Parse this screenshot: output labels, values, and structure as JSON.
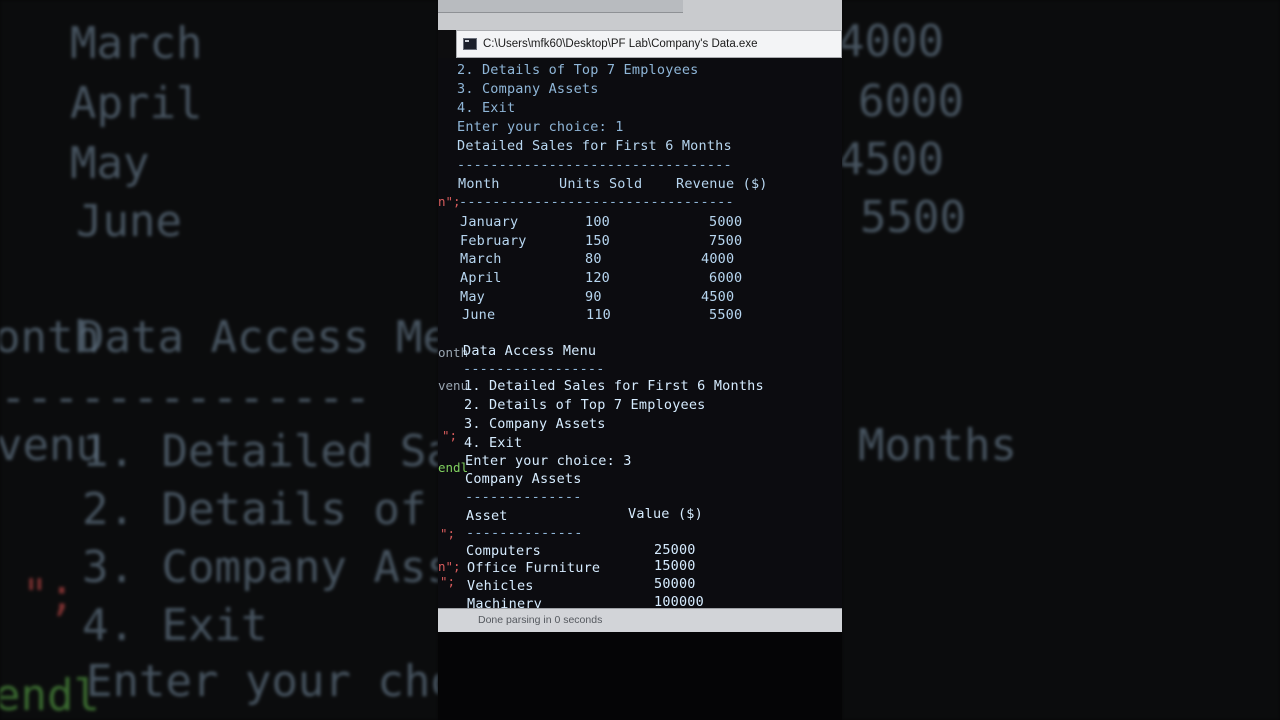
{
  "window": {
    "title": "C:\\Users\\mfk60\\Desktop\\PF Lab\\Company's Data.exe"
  },
  "console": {
    "menu_top": {
      "opt2": "2. Details of Top 7 Employees",
      "opt3": "3. Company Assets",
      "opt4": "4. Exit",
      "prompt": "Enter your choice: 1"
    },
    "sales": {
      "title": "Detailed Sales for First 6 Months",
      "divider": "---------------------------------",
      "header": {
        "month": "Month",
        "units": "Units Sold",
        "revenue": "Revenue ($)"
      },
      "divider2": "---------------------------------",
      "rows": [
        {
          "month": "January",
          "units": "100",
          "revenue": "5000"
        },
        {
          "month": "February",
          "units": "150",
          "revenue": "7500"
        },
        {
          "month": "March",
          "units": "80",
          "revenue": "4000"
        },
        {
          "month": "April",
          "units": "120",
          "revenue": "6000"
        },
        {
          "month": "May",
          "units": "90",
          "revenue": "4500"
        },
        {
          "month": "June",
          "units": "110",
          "revenue": "5500"
        }
      ]
    },
    "menu": {
      "title": "Data Access Menu",
      "divider": "-----------------",
      "opt1": "1. Detailed Sales for First 6 Months",
      "opt2": "2. Details of Top 7 Employees",
      "opt3": "3. Company Assets",
      "opt4": "4. Exit",
      "prompt": "Enter your choice: 3"
    },
    "assets": {
      "title": "Company Assets",
      "divider": "--------------",
      "header": {
        "asset": "Asset",
        "value": "Value ($)"
      },
      "divider2": "--------------",
      "rows": [
        {
          "asset": "Computers",
          "value": "25000"
        },
        {
          "asset": "Office Furniture",
          "value": "15000"
        },
        {
          "asset": "Vehicles",
          "value": "50000"
        },
        {
          "asset": "Machinery",
          "value": "100000"
        }
      ]
    }
  },
  "statusbar": {
    "text": "Done parsing in 0 seconds"
  },
  "background_code": {
    "left": {
      "march": "March",
      "april": "April",
      "may": "May",
      "june": "June",
      "month_frag": "onth",
      "menu_frag": "Data Access Me",
      "dash_frag": "--------------",
      "revenu_frag": "venu",
      "opt1_frag": "1. Detailed Sa",
      "opt2_frag": "2. Details of",
      "opt3_frag": "3. Company Ass",
      "opt4_frag": "4. Exit",
      "prompt_frag": "Enter your cho",
      "endl_frag": "endl",
      "semi_frag": "\";"
    },
    "right": {
      "v1": "4000",
      "v2": "6000",
      "v3": "4500",
      "v4": "5500",
      "months": "Months"
    },
    "inline": {
      "n_semi": "n\";",
      "onth": "onth",
      "venu": "venu",
      "semi1": "\";",
      "endl": "endl",
      "semi2": "\";",
      "n_semi2": "n\";",
      "semi3": "\";"
    }
  }
}
